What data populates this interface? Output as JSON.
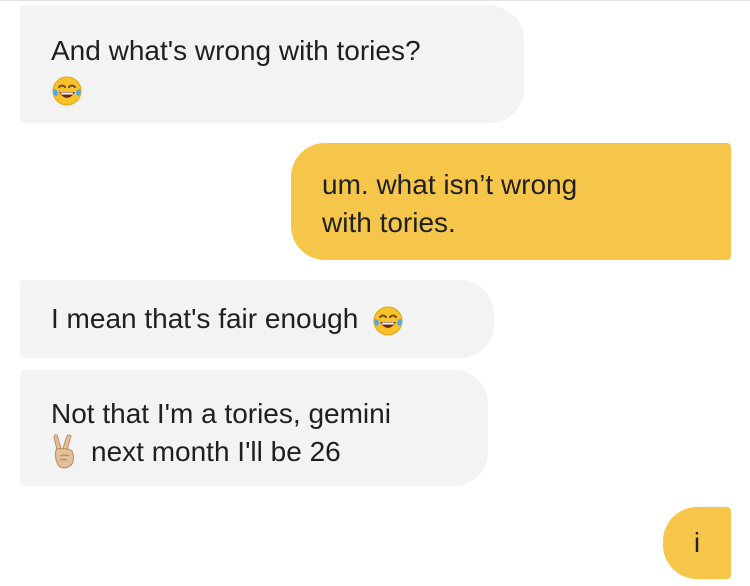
{
  "messages": [
    {
      "direction": "incoming",
      "text": "And what's wrong with tories?",
      "emoji": "tears-of-joy-icon"
    },
    {
      "direction": "outgoing",
      "lines": [
        "um. what isn’t wrong",
        "with tories."
      ]
    },
    {
      "direction": "incoming",
      "text": "I mean that's fair enough",
      "emoji": "tears-of-joy-icon"
    },
    {
      "direction": "incoming",
      "line1": "Not that I'm a tories, gemini",
      "emoji": "victory-hand-icon",
      "line2": "next month I'll be 26"
    },
    {
      "direction": "outgoing",
      "text": "i"
    }
  ],
  "colors": {
    "incoming_bubble": "#f3f3f3",
    "outgoing_bubble": "#f6c64a",
    "text": "#1f1f1f"
  }
}
